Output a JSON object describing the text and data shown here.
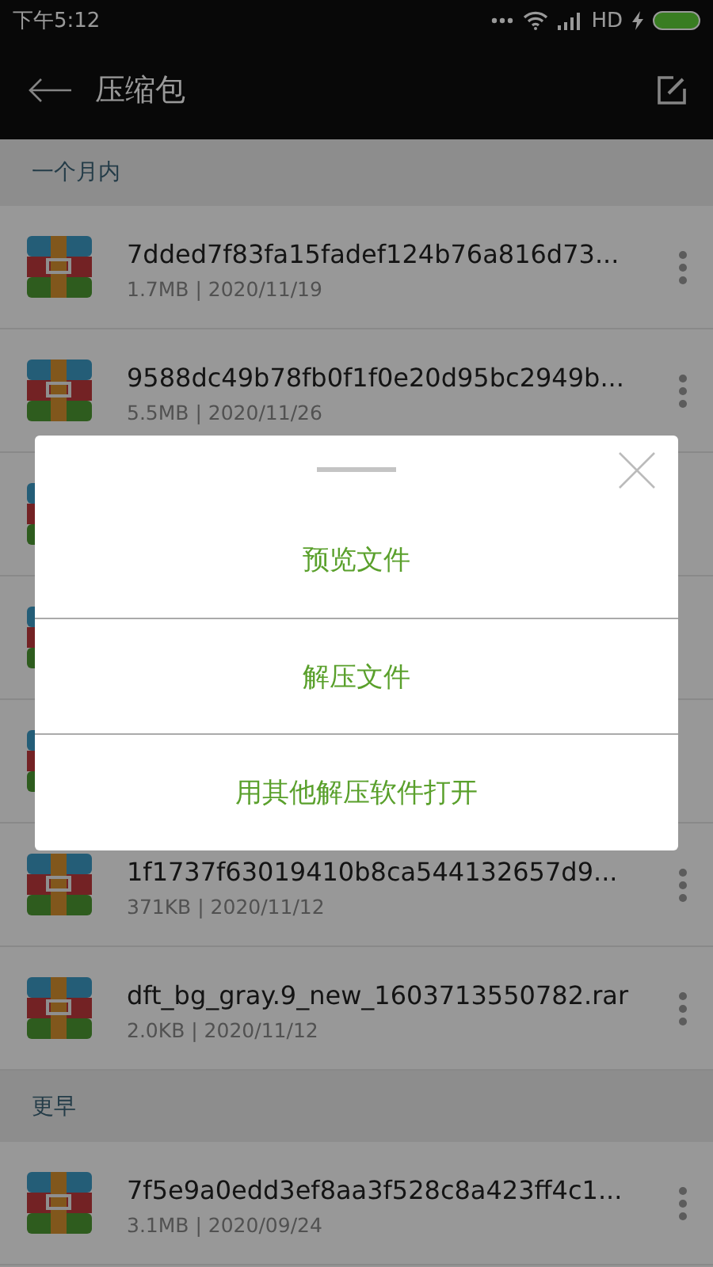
{
  "status_bar": {
    "time": "下午5:12",
    "network": "HD"
  },
  "app_bar": {
    "title": "压缩包"
  },
  "sections": [
    {
      "title": "一个月内",
      "files": [
        {
          "kind": "file",
          "name": "7dded7f83fa15fadef124b76a816d73...",
          "meta": "1.7MB | 2020/11/19"
        },
        {
          "kind": "file",
          "name": "9588dc49b78fb0f1f0e20d95bc2949b...",
          "meta": "5.5MB | 2020/11/26"
        },
        {
          "kind": "covered"
        },
        {
          "kind": "covered"
        },
        {
          "kind": "covered"
        },
        {
          "kind": "file",
          "name": "1f1737f63019410b8ca544132657d9...",
          "meta": "371KB | 2020/11/12"
        },
        {
          "kind": "file",
          "name": "dft_bg_gray.9_new_1603713550782.rar",
          "meta": "2.0KB | 2020/11/12"
        }
      ]
    },
    {
      "title": "更早",
      "files": [
        {
          "kind": "file",
          "name": "7f5e9a0edd3ef8aa3f528c8a423ff4c1...",
          "meta": "3.1MB | 2020/09/24"
        }
      ]
    }
  ],
  "dialog": {
    "options": [
      "预览文件",
      "解压文件",
      "用其他解压软件打开"
    ]
  }
}
